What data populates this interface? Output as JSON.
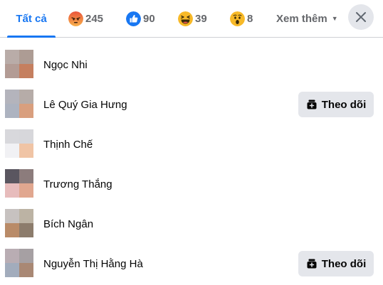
{
  "tabs": {
    "all": {
      "label": "Tất cả"
    },
    "angry": {
      "count": "245",
      "icon": "angry-reaction-icon",
      "color": "#f07a2c"
    },
    "like": {
      "count": "90",
      "icon": "like-reaction-icon",
      "color": "#1877f2"
    },
    "haha": {
      "count": "39",
      "icon": "haha-reaction-icon",
      "color": "#f7b928"
    },
    "wow": {
      "count": "8",
      "icon": "wow-reaction-icon",
      "color": "#f7b928"
    },
    "more": {
      "label": "Xem thêm"
    }
  },
  "close": {
    "icon": "close-icon"
  },
  "people": [
    {
      "name": "Ngọc Nhi",
      "avatar": [
        "#b9aca8",
        "#ad9c94",
        "#b39c95",
        "#c57f5f"
      ],
      "follow": null
    },
    {
      "name": "Lê Quý Gia Hưng",
      "avatar": [
        "#b4b4bc",
        "#b6aca8",
        "#adb3c0",
        "#d99f7e"
      ],
      "follow": "Theo dõi"
    },
    {
      "name": "Thịnh Chế",
      "avatar": [
        "#d8d8dc",
        "#d7d7db",
        "#f1f1f4",
        "#f0c4a5"
      ],
      "follow": null
    },
    {
      "name": "Trương Thắng",
      "avatar": [
        "#5a5660",
        "#8c7c7c",
        "#e7bcbc",
        "#e1a78f"
      ],
      "follow": null
    },
    {
      "name": "Bích Ngân",
      "avatar": [
        "#c7c2c0",
        "#bcb3a4",
        "#b98b68",
        "#8c7c6c"
      ],
      "follow": null
    },
    {
      "name": "Nguyễn Thị Hằng Hà",
      "avatar": [
        "#b9adb3",
        "#a6a0a3",
        "#a2acbc",
        "#a98874"
      ],
      "follow": "Theo dõi"
    }
  ]
}
